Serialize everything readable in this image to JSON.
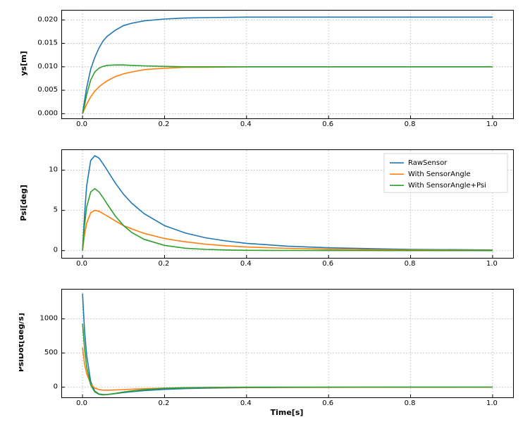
{
  "chart_data": [
    {
      "type": "line",
      "title": "",
      "xlabel": "",
      "ylabel": "ys[m]",
      "xlim": [
        -0.05,
        1.05
      ],
      "ylim": [
        -0.001,
        0.022
      ],
      "xticks": [
        0.0,
        0.2,
        0.4,
        0.6,
        0.8,
        1.0
      ],
      "yticks": [
        0.0,
        0.005,
        0.01,
        0.015,
        0.02
      ],
      "grid": true,
      "x": [
        0.0,
        0.005,
        0.01,
        0.02,
        0.03,
        0.04,
        0.05,
        0.06,
        0.08,
        0.1,
        0.12,
        0.15,
        0.2,
        0.25,
        0.3,
        0.4,
        0.5,
        0.6,
        0.8,
        1.0
      ],
      "series": [
        {
          "name": "RawSensor",
          "values": [
            0.0,
            0.0028,
            0.0055,
            0.0095,
            0.012,
            0.014,
            0.0155,
            0.0165,
            0.0178,
            0.0188,
            0.0193,
            0.0198,
            0.0202,
            0.0204,
            0.0205,
            0.0206,
            0.0206,
            0.0206,
            0.0206,
            0.0206
          ]
        },
        {
          "name": "With SensorAngle",
          "values": [
            0.0,
            0.001,
            0.002,
            0.0036,
            0.0048,
            0.0057,
            0.0064,
            0.007,
            0.0079,
            0.0085,
            0.0089,
            0.0094,
            0.0097,
            0.0099,
            0.0099,
            0.01,
            0.01,
            0.01,
            0.01,
            0.01
          ]
        },
        {
          "name": "With SensorAngle+Psi",
          "values": [
            0.0,
            0.0018,
            0.004,
            0.0072,
            0.0089,
            0.0097,
            0.0101,
            0.0103,
            0.0104,
            0.0104,
            0.0103,
            0.0102,
            0.0101,
            0.01,
            0.01,
            0.01,
            0.01,
            0.01,
            0.01,
            0.01
          ]
        }
      ]
    },
    {
      "type": "line",
      "title": "",
      "xlabel": "",
      "ylabel": "Psi[deg]",
      "xlim": [
        -0.05,
        1.05
      ],
      "ylim": [
        -0.9,
        12.5
      ],
      "xticks": [
        0.0,
        0.2,
        0.4,
        0.6,
        0.8,
        1.0
      ],
      "yticks": [
        0,
        5,
        10
      ],
      "grid": true,
      "legend": {
        "position": "upper-right",
        "entries": [
          "RawSensor",
          "With SensorAngle",
          "With SensorAngle+Psi"
        ]
      },
      "x": [
        0.0,
        0.005,
        0.01,
        0.02,
        0.03,
        0.04,
        0.05,
        0.06,
        0.08,
        0.1,
        0.12,
        0.15,
        0.2,
        0.25,
        0.3,
        0.35,
        0.4,
        0.5,
        0.6,
        0.8,
        1.0
      ],
      "series": [
        {
          "name": "RawSensor",
          "values": [
            0.0,
            4.5,
            8.0,
            11.2,
            11.8,
            11.5,
            10.8,
            10.0,
            8.4,
            7.0,
            5.9,
            4.6,
            3.1,
            2.2,
            1.6,
            1.2,
            0.9,
            0.55,
            0.35,
            0.15,
            0.08
          ]
        },
        {
          "name": "With SensorAngle",
          "values": [
            0.0,
            2.0,
            3.4,
            4.7,
            5.0,
            4.9,
            4.6,
            4.3,
            3.7,
            3.1,
            2.7,
            2.15,
            1.5,
            1.1,
            0.8,
            0.6,
            0.45,
            0.28,
            0.18,
            0.08,
            0.04
          ]
        },
        {
          "name": "With SensorAngle+Psi",
          "values": [
            0.0,
            3.2,
            5.4,
            7.3,
            7.7,
            7.3,
            6.6,
            5.8,
            4.3,
            3.1,
            2.25,
            1.4,
            0.65,
            0.3,
            0.15,
            0.08,
            0.04,
            0.02,
            0.01,
            0.005,
            0.0
          ]
        }
      ]
    },
    {
      "type": "line",
      "title": "",
      "xlabel": "Time[s]",
      "ylabel": "PsiDot[deg/s]",
      "xlim": [
        -0.05,
        1.05
      ],
      "ylim": [
        -150,
        1430
      ],
      "xticks": [
        0.0,
        0.2,
        0.4,
        0.6,
        0.8,
        1.0
      ],
      "yticks": [
        0,
        500,
        1000
      ],
      "grid": true,
      "x": [
        0.0,
        0.005,
        0.01,
        0.02,
        0.03,
        0.04,
        0.05,
        0.06,
        0.08,
        0.1,
        0.12,
        0.15,
        0.2,
        0.25,
        0.3,
        0.4,
        0.5,
        0.8,
        1.0
      ],
      "series": [
        {
          "name": "RawSensor",
          "values": [
            1370,
            820,
            470,
            80,
            -60,
            -100,
            -110,
            -108,
            -95,
            -80,
            -67,
            -52,
            -33,
            -22,
            -15,
            -8,
            -4,
            -1,
            0
          ]
        },
        {
          "name": "With SensorAngle",
          "values": [
            580,
            340,
            200,
            45,
            -15,
            -36,
            -45,
            -46,
            -42,
            -36,
            -30,
            -24,
            -15,
            -10,
            -7,
            -4,
            -2,
            -0.5,
            0
          ]
        },
        {
          "name": "With SensorAngle+Psi",
          "values": [
            930,
            570,
            300,
            30,
            -70,
            -105,
            -115,
            -110,
            -92,
            -72,
            -56,
            -38,
            -18,
            -9,
            -4,
            -1,
            -0.3,
            0,
            0
          ]
        }
      ]
    }
  ],
  "xlabel_global": "Time[s]"
}
